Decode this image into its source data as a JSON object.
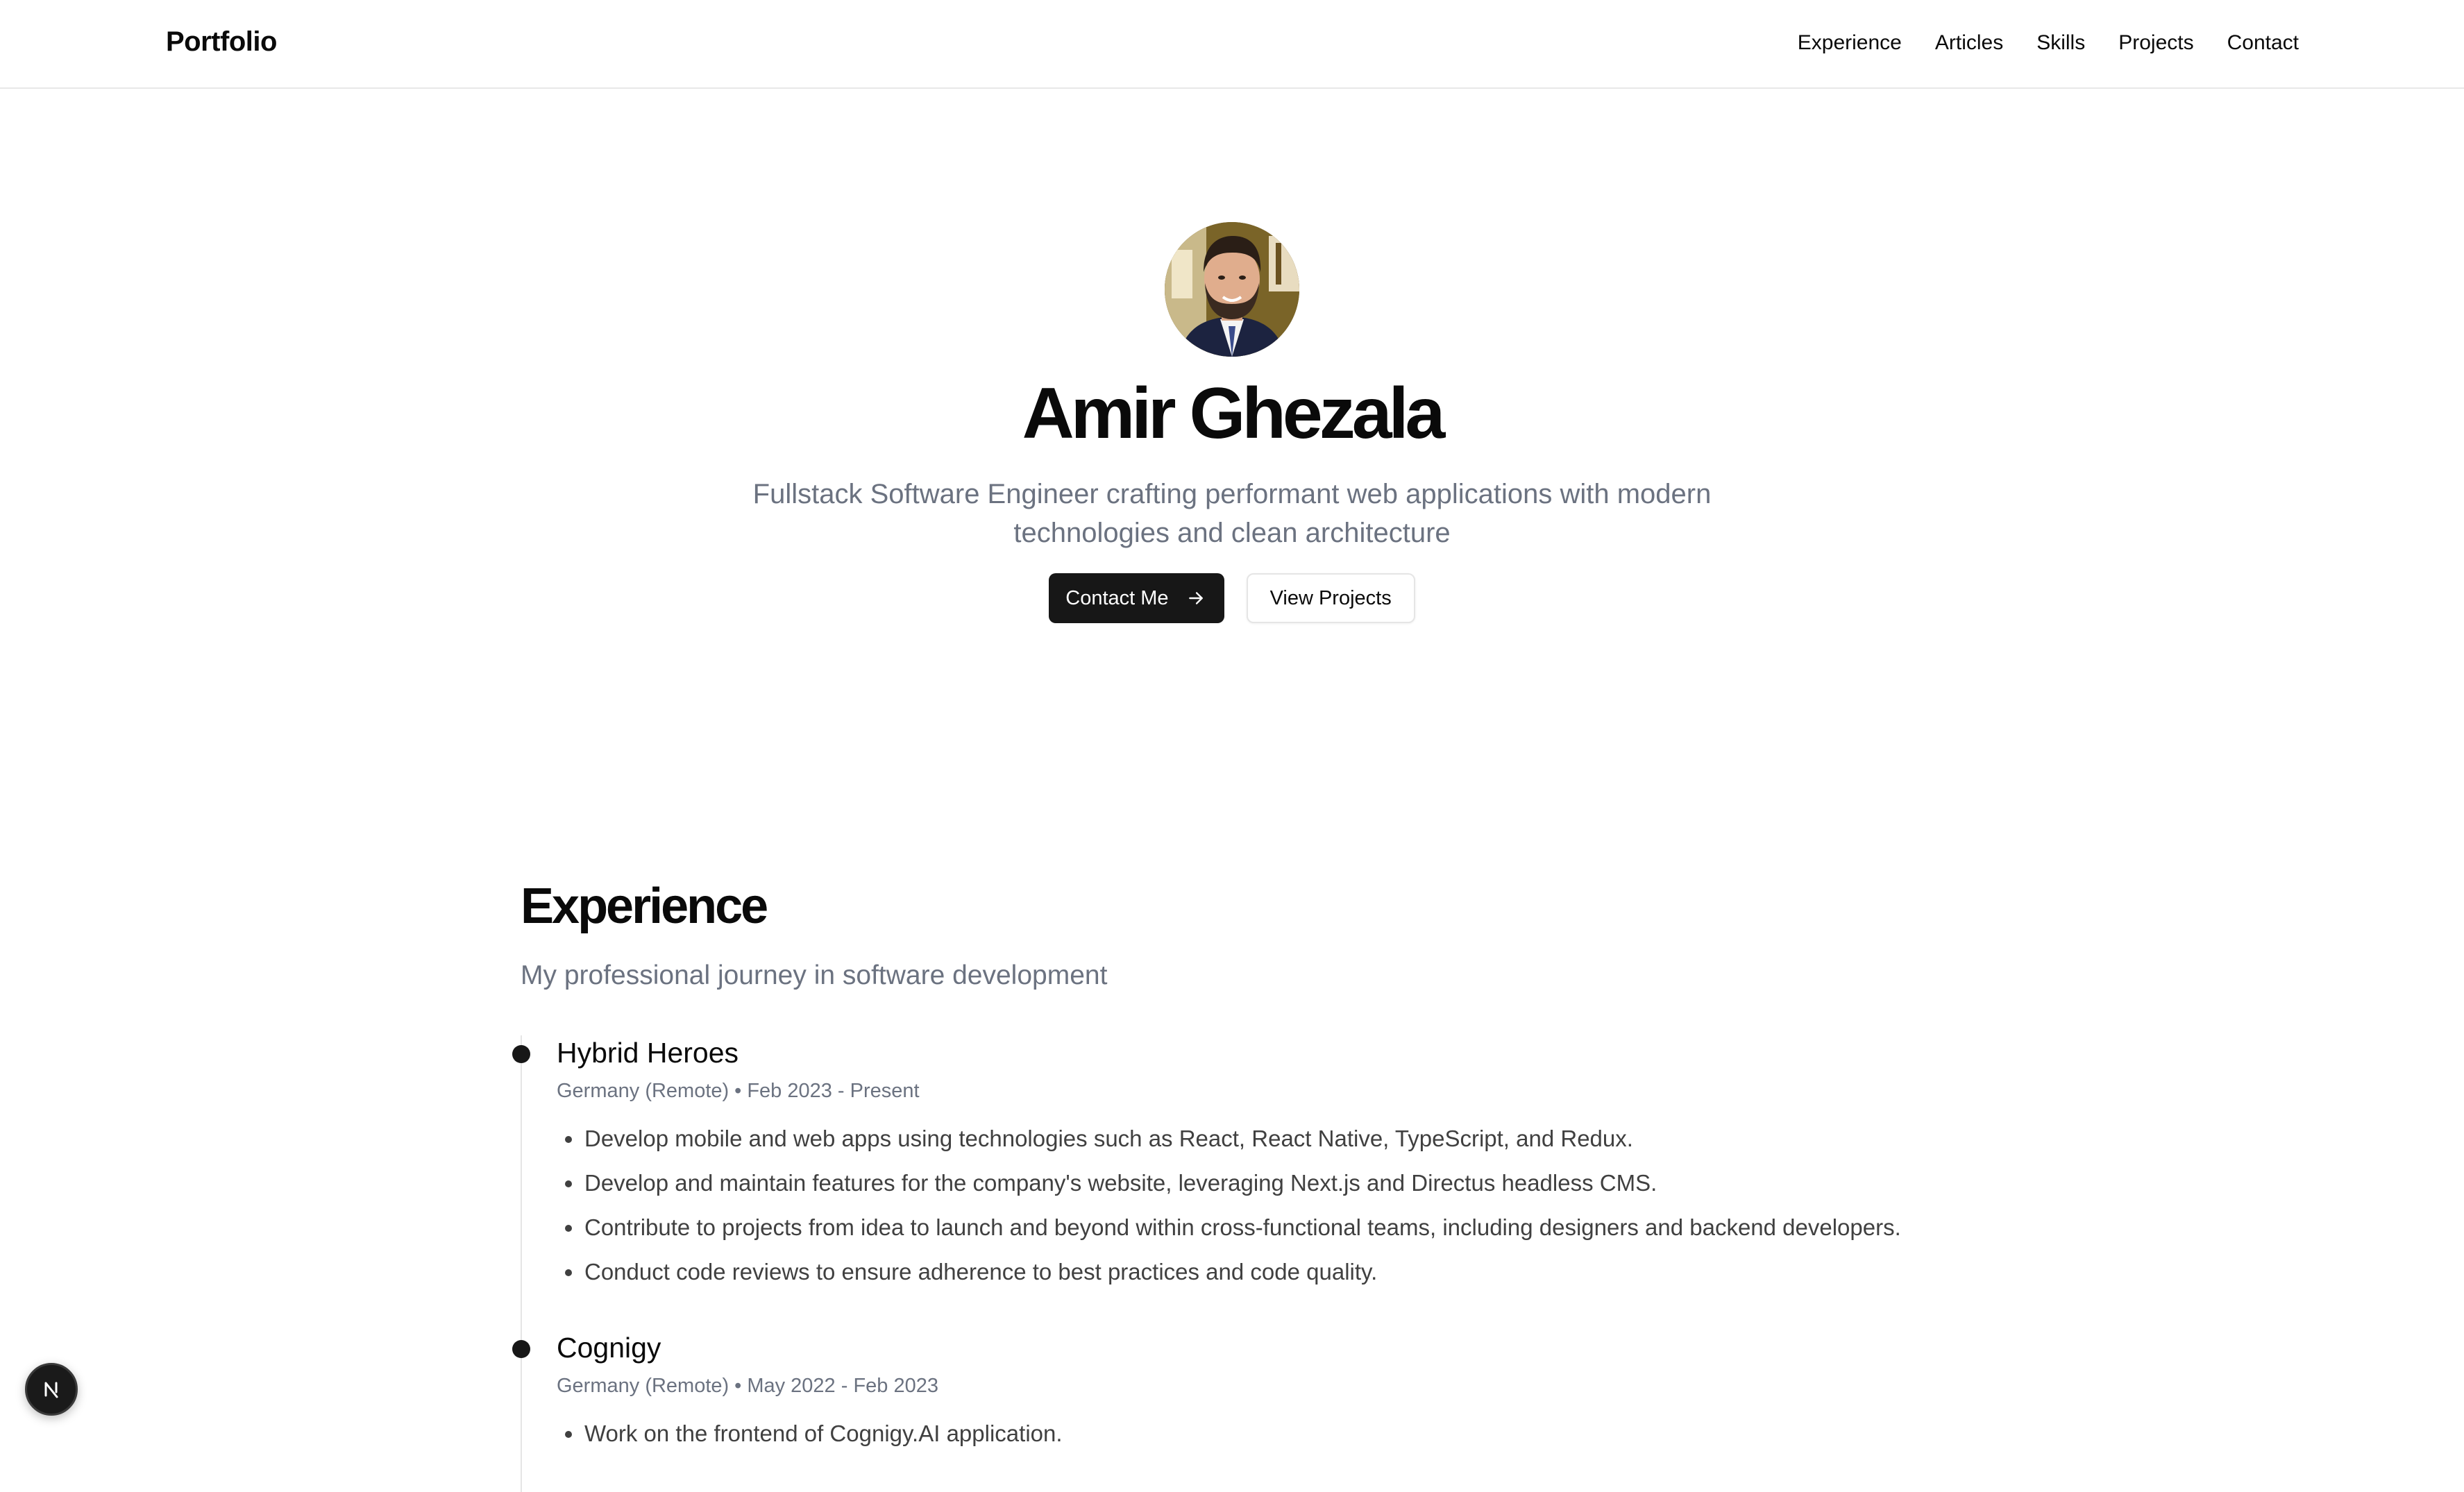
{
  "header": {
    "brand": "Portfolio",
    "nav": [
      "Experience",
      "Articles",
      "Skills",
      "Projects",
      "Contact"
    ]
  },
  "hero": {
    "name": "Amir Ghezala",
    "subtitle": "Fullstack Software Engineer crafting performant web applications with modern technologies and clean architecture",
    "primary_cta": "Contact Me",
    "secondary_cta": "View Projects"
  },
  "experience": {
    "title": "Experience",
    "subtitle": "My professional journey in software development",
    "jobs": [
      {
        "company": "Hybrid Heroes",
        "location": "Germany (Remote)",
        "separator": "•",
        "period": "Feb 2023 - Present",
        "points": [
          "Develop mobile and web apps using technologies such as React, React Native, TypeScript, and Redux.",
          "Develop and maintain features for the company's website, leveraging Next.js and Directus headless CMS.",
          "Contribute to projects from idea to launch and beyond within cross-functional teams, including designers and backend developers.",
          "Conduct code reviews to ensure adherence to best practices and code quality."
        ]
      },
      {
        "company": "Cognigy",
        "location": "Germany (Remote)",
        "separator": "•",
        "period": "May 2022 - Feb 2023",
        "points": [
          "Work on the frontend of Cognigy.AI application."
        ]
      }
    ]
  },
  "colors": {
    "primary": "#171717",
    "muted_text": "#6b7280",
    "border": "#e5e5e5"
  },
  "icons": {
    "cta_arrow": "arrow-right-icon",
    "dev_badge": "nextjs-logo-icon"
  }
}
